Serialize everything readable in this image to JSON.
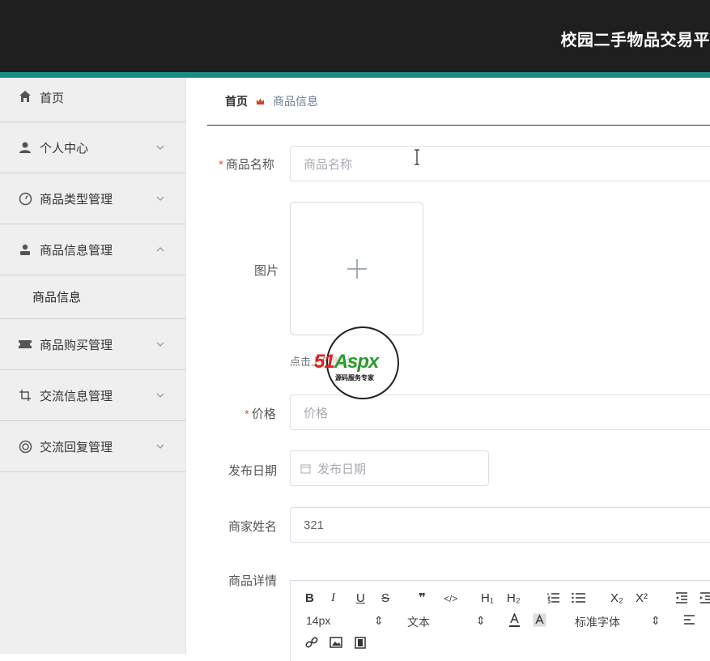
{
  "header": {
    "title": "校园二手物品交易平"
  },
  "sidebar": {
    "items": [
      {
        "label": "首页",
        "icon": "home-icon"
      },
      {
        "label": "个人中心",
        "icon": "user-icon"
      },
      {
        "label": "商品类型管理",
        "icon": "gauge-icon"
      },
      {
        "label": "商品信息管理",
        "icon": "person-icon",
        "expanded": true,
        "children": [
          "商品信息"
        ]
      },
      {
        "label": "商品购买管理",
        "icon": "ticket-icon"
      },
      {
        "label": "交流信息管理",
        "icon": "crop-icon"
      },
      {
        "label": "交流回复管理",
        "icon": "lifebuoy-icon"
      }
    ]
  },
  "breadcrumb": {
    "home": "首页",
    "current": "商品信息"
  },
  "form": {
    "name": {
      "label": "商品名称",
      "placeholder": "商品名称",
      "required": true
    },
    "image": {
      "label": "图片",
      "tip": "点击上传图片"
    },
    "price": {
      "label": "价格",
      "placeholder": "价格",
      "required": true
    },
    "date": {
      "label": "发布日期",
      "placeholder": "发布日期"
    },
    "merchant": {
      "label": "商家姓名",
      "value": "321"
    },
    "detail": {
      "label": "商品详情"
    }
  },
  "editor": {
    "bold": "B",
    "italic": "I",
    "underline": "U",
    "strike": "S",
    "quote": "❞",
    "code": "</>",
    "h1": "H₁",
    "h2": "H₂",
    "sub": "X₂",
    "sup": "X²",
    "size": "14px",
    "size_arrow": "⇕",
    "format": "文本",
    "format_arrow": "⇕",
    "font": "标准字体",
    "font_arrow": "⇕"
  },
  "watermark": {
    "text_a": "51",
    "text_b": "Aspx",
    "sub": "源码服务专家"
  },
  "colors": {
    "topbar": "#1f1f1f",
    "accent": "#1b8c84",
    "sidebar": "#efefef",
    "required": "#e5534b"
  }
}
